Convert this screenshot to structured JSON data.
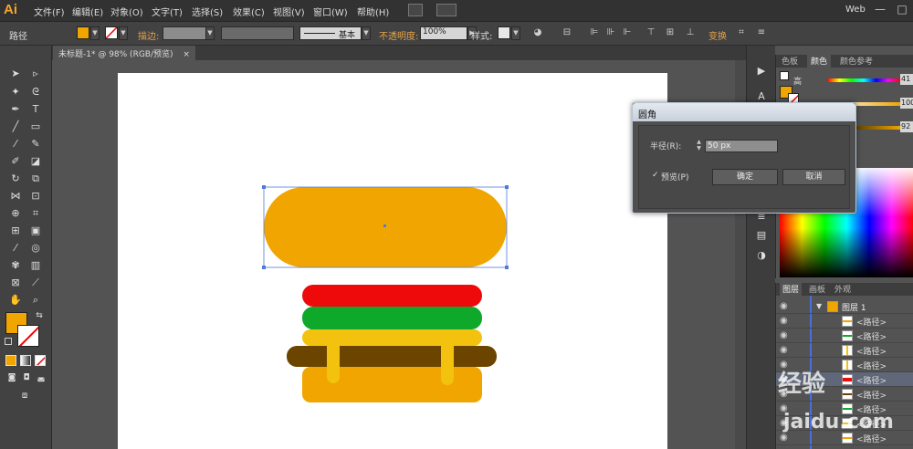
{
  "app": {
    "logo": "Ai"
  },
  "menu": {
    "items": [
      "文件(F)",
      "编辑(E)",
      "对象(O)",
      "文字(T)",
      "选择(S)",
      "效果(C)",
      "视图(V)",
      "窗口(W)",
      "帮助(H)"
    ],
    "workspace": "Web",
    "minimize": "—",
    "maximize": "□",
    "close": "✕"
  },
  "control_bar": {
    "object_type": "路径",
    "stroke_label": "描边:",
    "stroke_profile": "基本",
    "opacity_label": "不透明度:",
    "opacity_value": "100%",
    "style_label": "样式:",
    "transform_label": "变换",
    "fill_color": "#f0a500"
  },
  "document": {
    "tab_title": "未标题-1* @ 98% (RGB/预览)",
    "tab_close": "×"
  },
  "colors": {
    "bun": "#f0a500",
    "tomato": "#ee0a0a",
    "lettuce": "#0ea82b",
    "cheese": "#f2c20f",
    "patty": "#6b4400",
    "selection": "#4f7bdb"
  },
  "color_panel": {
    "tabs": [
      "色板",
      "颜色",
      "颜色参考"
    ],
    "active_tab": "颜色",
    "channel_label": "高",
    "values": [
      "41",
      "100",
      "92"
    ]
  },
  "layers_panel": {
    "tabs": [
      "图层",
      "画板",
      "外观"
    ],
    "layer_name": "图层 1",
    "sublayers": [
      "<路径>",
      "<路径>",
      "<路径>",
      "<路径>",
      "<路径>",
      "<路径>",
      "<路径>",
      "<路径>",
      "<路径>",
      "<路径>"
    ]
  },
  "dialog": {
    "title": "圆角",
    "radius_label": "半径(R):",
    "radius_value": "50 px",
    "preview_label": "预览(P)",
    "ok_label": "确定",
    "cancel_label": "取消"
  },
  "watermark": {
    "text": "经验",
    "url": "jaidu.com"
  }
}
